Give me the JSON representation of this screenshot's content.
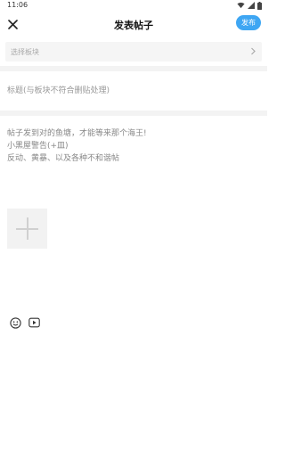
{
  "status_bar": {
    "time": "11:06",
    "icons": [
      "wifi-icon",
      "signal-icon",
      "battery-icon"
    ]
  },
  "header": {
    "title": "发表帖子",
    "publish_label": "发布",
    "close_icon": "close-icon"
  },
  "section_select": {
    "placeholder": "选择板块",
    "icon": "chevron-right-icon"
  },
  "title_field": {
    "placeholder": "标题(与板块不符合删贴处理)"
  },
  "body_field": {
    "placeholder_lines": [
      "帖子发到对的鱼塘，才能等来那个海王!",
      "小黑屋警告(+皿)",
      "反动、黄暴、以及各种不和谐帖"
    ]
  },
  "toolbar": {
    "items": [
      "emoji-icon",
      "video-icon"
    ]
  },
  "colors": {
    "accent": "#3ea6f3",
    "placeholder_text": "#999999",
    "divider": "#f3f3f3"
  }
}
